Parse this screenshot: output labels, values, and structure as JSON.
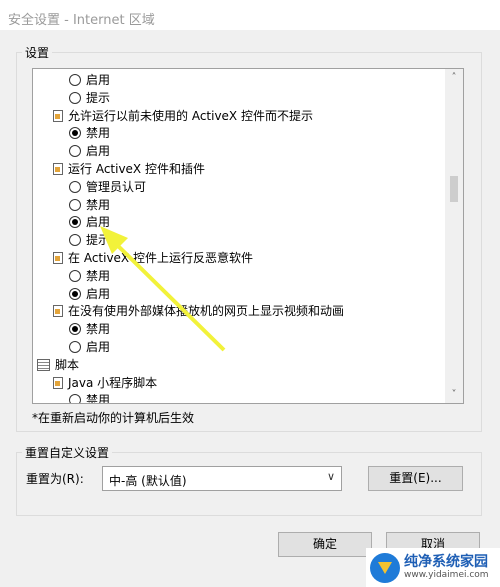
{
  "window": {
    "title": "安全设置 - Internet 区域"
  },
  "settings_group": {
    "label": "设置",
    "items": [
      {
        "kind": "radio",
        "label": "启用",
        "checked": false
      },
      {
        "kind": "radio",
        "label": "提示",
        "checked": false
      },
      {
        "kind": "heading",
        "label": "允许运行以前未使用的 ActiveX 控件而不提示"
      },
      {
        "kind": "radio",
        "label": "禁用",
        "checked": true
      },
      {
        "kind": "radio",
        "label": "启用",
        "checked": false
      },
      {
        "kind": "heading",
        "label": "运行 ActiveX 控件和插件"
      },
      {
        "kind": "radio",
        "label": "管理员认可",
        "checked": false
      },
      {
        "kind": "radio",
        "label": "禁用",
        "checked": false
      },
      {
        "kind": "radio",
        "label": "启用",
        "checked": true
      },
      {
        "kind": "radio",
        "label": "提示",
        "checked": false
      },
      {
        "kind": "heading",
        "label": "在 ActiveX 控件上运行反恶意软件"
      },
      {
        "kind": "radio",
        "label": "禁用",
        "checked": false
      },
      {
        "kind": "radio",
        "label": "启用",
        "checked": true
      },
      {
        "kind": "heading",
        "label": "在没有使用外部媒体播放机的网页上显示视频和动画"
      },
      {
        "kind": "radio",
        "label": "禁用",
        "checked": true
      },
      {
        "kind": "radio",
        "label": "启用",
        "checked": false
      },
      {
        "kind": "category",
        "label": "脚本"
      },
      {
        "kind": "heading",
        "label": "Java 小程序脚本"
      },
      {
        "kind": "radio",
        "label": "禁用",
        "checked": false
      }
    ],
    "note": "*在重新启动你的计算机后生效"
  },
  "reset_group": {
    "label": "重置自定义设置",
    "reset_to_label": "重置为(R):",
    "level_value": "中-高 (默认值)",
    "reset_button": "重置(E)..."
  },
  "footer": {
    "ok_button": "确定",
    "cancel_button": "取消"
  },
  "watermark": {
    "title": "纯净系统家园",
    "url": "www.yidaimei.com"
  },
  "colors": {
    "annotation_arrow": "#f2f23a",
    "logo_blue": "#1f7bd8"
  }
}
